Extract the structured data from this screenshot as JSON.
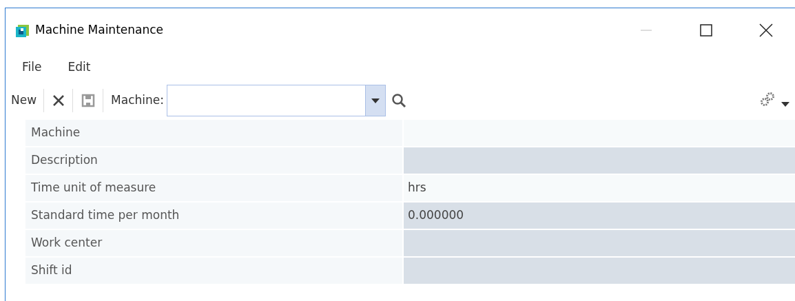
{
  "window": {
    "title": "Machine Maintenance"
  },
  "menu": [
    "File",
    "Edit"
  ],
  "toolbar": {
    "new_label": "New",
    "machine_label": "Machine:"
  },
  "fields": [
    {
      "label": "Machine",
      "readonly": false
    },
    {
      "label": "Description",
      "readonly": true
    },
    {
      "label": "Time unit of measure",
      "value": "hrs",
      "readonly": false
    },
    {
      "label": "Standard time per month",
      "value": "0.000000",
      "readonly": true
    },
    {
      "label": "Work center",
      "readonly": true
    },
    {
      "label": "Shift id",
      "readonly": true
    }
  ]
}
